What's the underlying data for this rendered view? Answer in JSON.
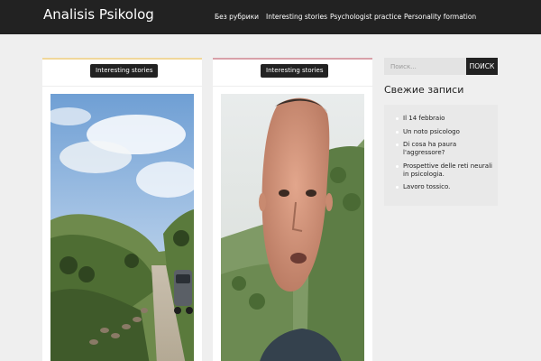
{
  "header": {
    "site_title": "Analisis Psikolog",
    "nav": [
      {
        "label": "Без рубрики"
      },
      {
        "label": "Interesting stories"
      },
      {
        "label": "Psychologist practice"
      },
      {
        "label": "Personality formation"
      }
    ]
  },
  "posts": [
    {
      "category": "Interesting stories",
      "image": "landscape-road-photo"
    },
    {
      "category": "Interesting stories",
      "image": "selfie-face-photo"
    }
  ],
  "sidebar": {
    "search": {
      "placeholder": "Поиск...",
      "button_label": "ПОИСК"
    },
    "recent": {
      "title": "Свежие записи",
      "items": [
        {
          "label": "Il 14 febbraio"
        },
        {
          "label": "Un noto psicologo"
        },
        {
          "label": "Di cosa ha paura l'aggressore?"
        },
        {
          "label": "Prospettive delle reti neurali in psicologia."
        },
        {
          "label": "Lavoro tossico."
        }
      ]
    }
  },
  "colors": {
    "header_bg": "#222222",
    "page_bg": "#efefef",
    "card1_accent": "#f0d79a",
    "card2_accent": "#d8a0a8"
  }
}
